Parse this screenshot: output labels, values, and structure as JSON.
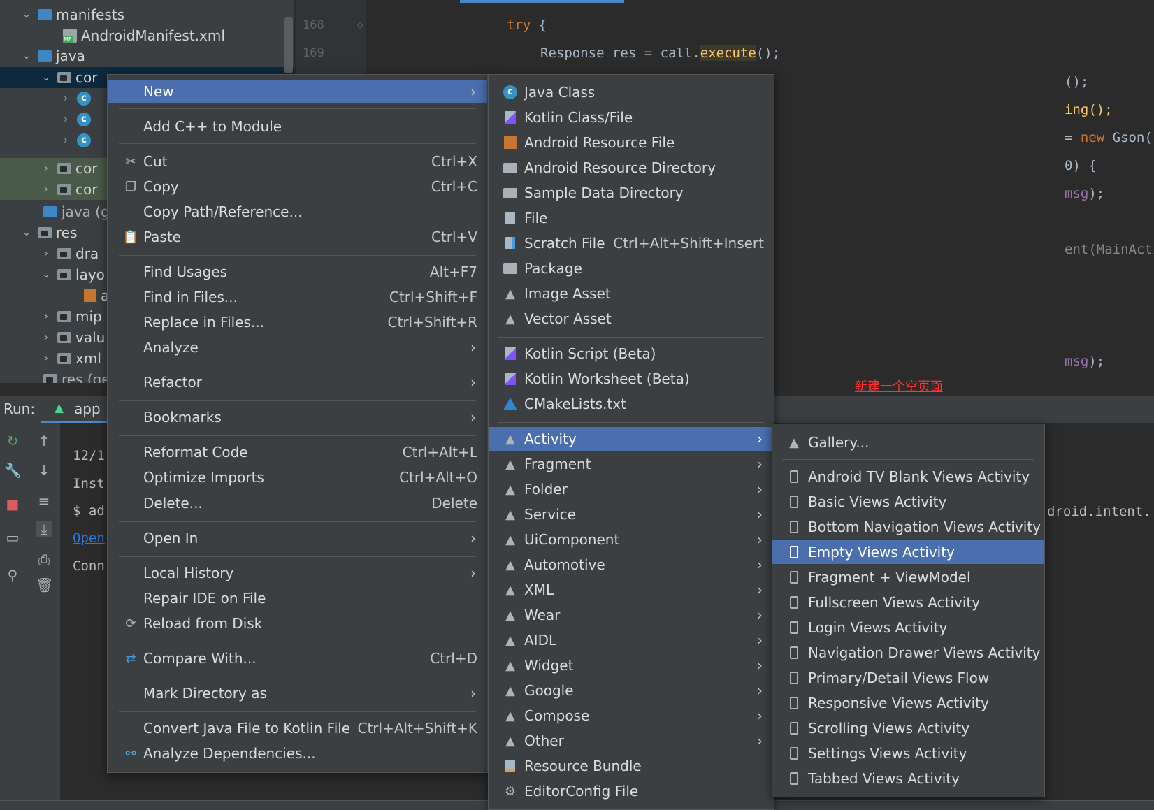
{
  "tree": {
    "rows": [
      {
        "label": "manifests"
      },
      {
        "label": "AndroidManifest.xml"
      },
      {
        "label": "java"
      },
      {
        "label": "cor"
      },
      {
        "label": ""
      },
      {
        "label": ""
      },
      {
        "label": ""
      },
      {
        "label": "cor"
      },
      {
        "label": "cor"
      },
      {
        "label": "java (g"
      },
      {
        "label": "res"
      },
      {
        "label": "dra"
      },
      {
        "label": "layo"
      },
      {
        "label": "a"
      },
      {
        "label": "mip"
      },
      {
        "label": "valu"
      },
      {
        "label": "xml"
      },
      {
        "label": "res (ge"
      }
    ]
  },
  "editor": {
    "line_numbers": [
      "168",
      "169"
    ],
    "code": {
      "l1_kw": "try",
      "l1_rest": " {",
      "l2_a": "Response res = call.",
      "l2_fn": "execute",
      "l2_b": "();",
      "l3": "();",
      "l4": "ing();",
      "l5_a": "= ",
      "l5_kw": "new",
      "l5_b": " Gson().fromJson(dataString, LoginRespons",
      "l6": "0) {",
      "l7_purple": "msg",
      "l7_b": ");",
      "l8": "ent(MainActivity.this,);",
      "l9_purple": "msg",
      "l9_b": ");"
    },
    "note": "新建一个空页面"
  },
  "run": {
    "label": "Run:",
    "tab": "app",
    "console": [
      "12/1",
      "Inst",
      "$ ad",
      "Open",
      "Conn"
    ],
    "console_right": "droid.intent."
  },
  "menu_main": {
    "items": [
      {
        "label": "New",
        "shortcut": "",
        "submenu": true
      },
      {
        "label": "Add C++ to Module",
        "shortcut": "",
        "submenu": false
      },
      {
        "label": "Cut",
        "shortcut": "Ctrl+X",
        "submenu": false
      },
      {
        "label": "Copy",
        "shortcut": "Ctrl+C",
        "submenu": false
      },
      {
        "label": "Copy Path/Reference...",
        "shortcut": "",
        "submenu": false
      },
      {
        "label": "Paste",
        "shortcut": "Ctrl+V",
        "submenu": false
      },
      {
        "label": "Find Usages",
        "shortcut": "Alt+F7",
        "submenu": false
      },
      {
        "label": "Find in Files...",
        "shortcut": "Ctrl+Shift+F",
        "submenu": false
      },
      {
        "label": "Replace in Files...",
        "shortcut": "Ctrl+Shift+R",
        "submenu": false
      },
      {
        "label": "Analyze",
        "shortcut": "",
        "submenu": true
      },
      {
        "label": "Refactor",
        "shortcut": "",
        "submenu": true
      },
      {
        "label": "Bookmarks",
        "shortcut": "",
        "submenu": true
      },
      {
        "label": "Reformat Code",
        "shortcut": "Ctrl+Alt+L",
        "submenu": false
      },
      {
        "label": "Optimize Imports",
        "shortcut": "Ctrl+Alt+O",
        "submenu": false
      },
      {
        "label": "Delete...",
        "shortcut": "Delete",
        "submenu": false
      },
      {
        "label": "Open In",
        "shortcut": "",
        "submenu": true
      },
      {
        "label": "Local History",
        "shortcut": "",
        "submenu": true
      },
      {
        "label": "Repair IDE on File",
        "shortcut": "",
        "submenu": false
      },
      {
        "label": "Reload from Disk",
        "shortcut": "",
        "submenu": false
      },
      {
        "label": "Compare With...",
        "shortcut": "Ctrl+D",
        "submenu": false
      },
      {
        "label": "Mark Directory as",
        "shortcut": "",
        "submenu": true
      },
      {
        "label": "Convert Java File to Kotlin File",
        "shortcut": "Ctrl+Alt+Shift+K",
        "submenu": false
      },
      {
        "label": "Analyze Dependencies...",
        "shortcut": "",
        "submenu": false
      }
    ]
  },
  "menu_new": {
    "items": [
      {
        "label": "Java Class",
        "shortcut": "",
        "submenu": false
      },
      {
        "label": "Kotlin Class/File",
        "shortcut": "",
        "submenu": false
      },
      {
        "label": "Android Resource File",
        "shortcut": "",
        "submenu": false
      },
      {
        "label": "Android Resource Directory",
        "shortcut": "",
        "submenu": false
      },
      {
        "label": "Sample Data Directory",
        "shortcut": "",
        "submenu": false
      },
      {
        "label": "File",
        "shortcut": "",
        "submenu": false
      },
      {
        "label": "Scratch File",
        "shortcut": "Ctrl+Alt+Shift+Insert",
        "submenu": false
      },
      {
        "label": "Package",
        "shortcut": "",
        "submenu": false
      },
      {
        "label": "Image Asset",
        "shortcut": "",
        "submenu": false
      },
      {
        "label": "Vector Asset",
        "shortcut": "",
        "submenu": false
      },
      {
        "label": "Kotlin Script (Beta)",
        "shortcut": "",
        "submenu": false
      },
      {
        "label": "Kotlin Worksheet (Beta)",
        "shortcut": "",
        "submenu": false
      },
      {
        "label": "CMakeLists.txt",
        "shortcut": "",
        "submenu": false
      },
      {
        "label": "Activity",
        "shortcut": "",
        "submenu": true
      },
      {
        "label": "Fragment",
        "shortcut": "",
        "submenu": true
      },
      {
        "label": "Folder",
        "shortcut": "",
        "submenu": true
      },
      {
        "label": "Service",
        "shortcut": "",
        "submenu": true
      },
      {
        "label": "UiComponent",
        "shortcut": "",
        "submenu": true
      },
      {
        "label": "Automotive",
        "shortcut": "",
        "submenu": true
      },
      {
        "label": "XML",
        "shortcut": "",
        "submenu": true
      },
      {
        "label": "Wear",
        "shortcut": "",
        "submenu": true
      },
      {
        "label": "AIDL",
        "shortcut": "",
        "submenu": true
      },
      {
        "label": "Widget",
        "shortcut": "",
        "submenu": true
      },
      {
        "label": "Google",
        "shortcut": "",
        "submenu": true
      },
      {
        "label": "Compose",
        "shortcut": "",
        "submenu": true
      },
      {
        "label": "Other",
        "shortcut": "",
        "submenu": true
      },
      {
        "label": "Resource Bundle",
        "shortcut": "",
        "submenu": false
      },
      {
        "label": "EditorConfig File",
        "shortcut": "",
        "submenu": false
      }
    ]
  },
  "menu_activity": {
    "items": [
      {
        "label": "Gallery..."
      },
      {
        "label": "Android TV Blank Views Activity"
      },
      {
        "label": "Basic Views Activity"
      },
      {
        "label": "Bottom Navigation Views Activity"
      },
      {
        "label": "Empty Views Activity"
      },
      {
        "label": "Fragment + ViewModel"
      },
      {
        "label": "Fullscreen Views Activity"
      },
      {
        "label": "Login Views Activity"
      },
      {
        "label": "Navigation Drawer Views Activity"
      },
      {
        "label": "Primary/Detail Views Flow"
      },
      {
        "label": "Responsive Views Activity"
      },
      {
        "label": "Scrolling Views Activity"
      },
      {
        "label": "Settings Views Activity"
      },
      {
        "label": "Tabbed Views Activity"
      }
    ]
  },
  "colors": {
    "menu_bg": "#3c3f41",
    "highlight": "#4b6eaf",
    "android_green": "#3ddc84",
    "editor_bg": "#2b2b2b"
  }
}
